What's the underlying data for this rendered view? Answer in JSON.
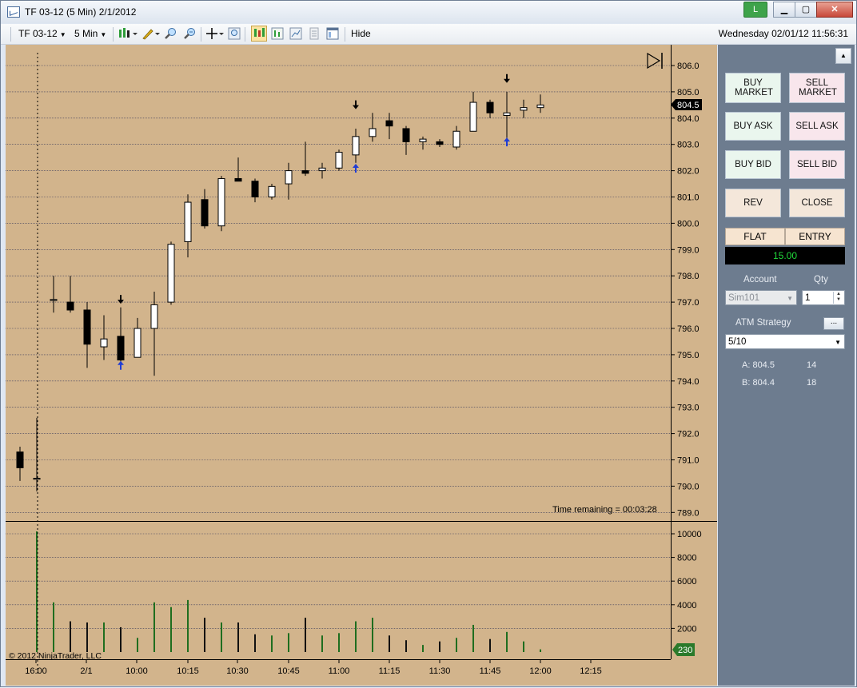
{
  "window": {
    "title": "TF 03-12 (5 Min)  2/1/2012",
    "buttons": {
      "link": "L",
      "minimize": "▁",
      "maximize": "▢",
      "close": "✕"
    }
  },
  "toolbar": {
    "instrument": "TF 03-12",
    "interval": "5 Min",
    "hide_label": "Hide",
    "datetime": "Wednesday 02/01/12 11:56:31"
  },
  "chart_data": {
    "type": "candlestick",
    "instrument": "TF 03-12",
    "interval": "5 Min",
    "date": "2/1/2012",
    "price_axis": {
      "min": 789.0,
      "max": 806.0,
      "ticks": [
        "806.0",
        "805.0",
        "804.0",
        "803.0",
        "802.0",
        "801.0",
        "800.0",
        "799.0",
        "798.0",
        "797.0",
        "796.0",
        "795.0",
        "794.0",
        "793.0",
        "792.0",
        "791.0",
        "790.0",
        "789.0"
      ]
    },
    "volume_axis": {
      "ticks": [
        "10000",
        "8000",
        "6000",
        "4000",
        "2000"
      ]
    },
    "time_labels": [
      "16:00",
      "2/1",
      "10:00",
      "10:15",
      "10:30",
      "10:45",
      "11:00",
      "11:15",
      "11:30",
      "11:45",
      "12:00",
      "12:15"
    ],
    "last_price": "804.5",
    "last_volume": "230",
    "time_remaining": "Time remaining = 00:03:28",
    "copyright": "© 2012 NinjaTrader, LLC",
    "grid": true,
    "candles": [
      {
        "o": 791.3,
        "h": 791.5,
        "l": 790.2,
        "c": 790.7
      },
      {
        "o": 790.3,
        "h": 792.6,
        "l": 789.8,
        "c": 790.3
      },
      {
        "o": 797.1,
        "h": 798.0,
        "l": 796.6,
        "c": 797.1
      },
      {
        "o": 797.0,
        "h": 798.0,
        "l": 796.6,
        "c": 796.7
      },
      {
        "o": 796.7,
        "h": 797.0,
        "l": 794.5,
        "c": 795.4
      },
      {
        "o": 795.3,
        "h": 796.5,
        "l": 794.8,
        "c": 795.6
      },
      {
        "o": 795.7,
        "h": 796.8,
        "l": 794.5,
        "c": 794.8
      },
      {
        "o": 794.9,
        "h": 796.4,
        "l": 794.9,
        "c": 796.0
      },
      {
        "o": 796.0,
        "h": 797.4,
        "l": 794.2,
        "c": 796.9
      },
      {
        "o": 797.0,
        "h": 799.3,
        "l": 796.9,
        "c": 799.2
      },
      {
        "o": 799.3,
        "h": 801.1,
        "l": 798.7,
        "c": 800.8
      },
      {
        "o": 800.9,
        "h": 801.3,
        "l": 799.8,
        "c": 799.9
      },
      {
        "o": 799.9,
        "h": 801.8,
        "l": 799.7,
        "c": 801.7
      },
      {
        "o": 801.7,
        "h": 802.5,
        "l": 801.6,
        "c": 801.6
      },
      {
        "o": 801.6,
        "h": 801.7,
        "l": 800.8,
        "c": 801.0
      },
      {
        "o": 801.0,
        "h": 801.5,
        "l": 800.9,
        "c": 801.4
      },
      {
        "o": 801.5,
        "h": 802.3,
        "l": 800.9,
        "c": 802.0
      },
      {
        "o": 802.0,
        "h": 803.1,
        "l": 801.8,
        "c": 801.9
      },
      {
        "o": 802.0,
        "h": 802.3,
        "l": 801.7,
        "c": 802.1
      },
      {
        "o": 802.1,
        "h": 802.8,
        "l": 802.0,
        "c": 802.7
      },
      {
        "o": 802.6,
        "h": 803.6,
        "l": 802.3,
        "c": 803.3
      },
      {
        "o": 803.3,
        "h": 804.2,
        "l": 803.1,
        "c": 803.6
      },
      {
        "o": 803.9,
        "h": 804.2,
        "l": 803.2,
        "c": 803.7
      },
      {
        "o": 803.6,
        "h": 803.7,
        "l": 802.6,
        "c": 803.1
      },
      {
        "o": 803.1,
        "h": 803.3,
        "l": 802.8,
        "c": 803.2
      },
      {
        "o": 803.1,
        "h": 803.2,
        "l": 802.9,
        "c": 803.0
      },
      {
        "o": 802.9,
        "h": 803.7,
        "l": 802.8,
        "c": 803.5
      },
      {
        "o": 803.5,
        "h": 805.0,
        "l": 803.5,
        "c": 804.6
      },
      {
        "o": 804.6,
        "h": 804.7,
        "l": 804.0,
        "c": 804.2
      },
      {
        "o": 804.1,
        "h": 805.0,
        "l": 803.0,
        "c": 804.2
      },
      {
        "o": 804.3,
        "h": 804.7,
        "l": 804.0,
        "c": 804.4
      },
      {
        "o": 804.4,
        "h": 804.9,
        "l": 804.2,
        "c": 804.5
      }
    ],
    "volumes": [
      0,
      10200,
      4200,
      2600,
      2500,
      2500,
      2100,
      1200,
      4200,
      3800,
      4400,
      2900,
      2500,
      2500,
      1500,
      1400,
      1600,
      2900,
      1400,
      1600,
      2600,
      2900,
      1400,
      1000,
      600,
      900,
      1200,
      2300,
      1100,
      1700,
      900,
      230
    ],
    "trade_markers": [
      {
        "bar": 6,
        "type": "exit",
        "price": 797.0
      },
      {
        "bar": 6,
        "type": "entry",
        "price": 794.7
      },
      {
        "bar": 20,
        "type": "exit",
        "price": 804.4
      },
      {
        "bar": 20,
        "type": "entry",
        "price": 802.2
      },
      {
        "bar": 29,
        "type": "exit",
        "price": 805.4
      },
      {
        "bar": 29,
        "type": "entry",
        "price": 803.2
      }
    ]
  },
  "panel": {
    "buy_market": "BUY MARKET",
    "sell_market": "SELL MARKET",
    "buy_ask": "BUY ASK",
    "sell_ask": "SELL ASK",
    "buy_bid": "BUY BID",
    "sell_bid": "SELL BID",
    "rev": "REV",
    "close": "CLOSE",
    "flat": "FLAT",
    "entry": "ENTRY",
    "pnl": "15.00",
    "account_label": "Account",
    "account_value": "Sim101",
    "qty_label": "Qty",
    "qty_value": "1",
    "atm_label": "ATM Strategy",
    "atm_more": "...",
    "atm_value": "5/10",
    "ask_label": "A: 804.5",
    "ask_size": "14",
    "bid_label": "B: 804.4",
    "bid_size": "18"
  }
}
